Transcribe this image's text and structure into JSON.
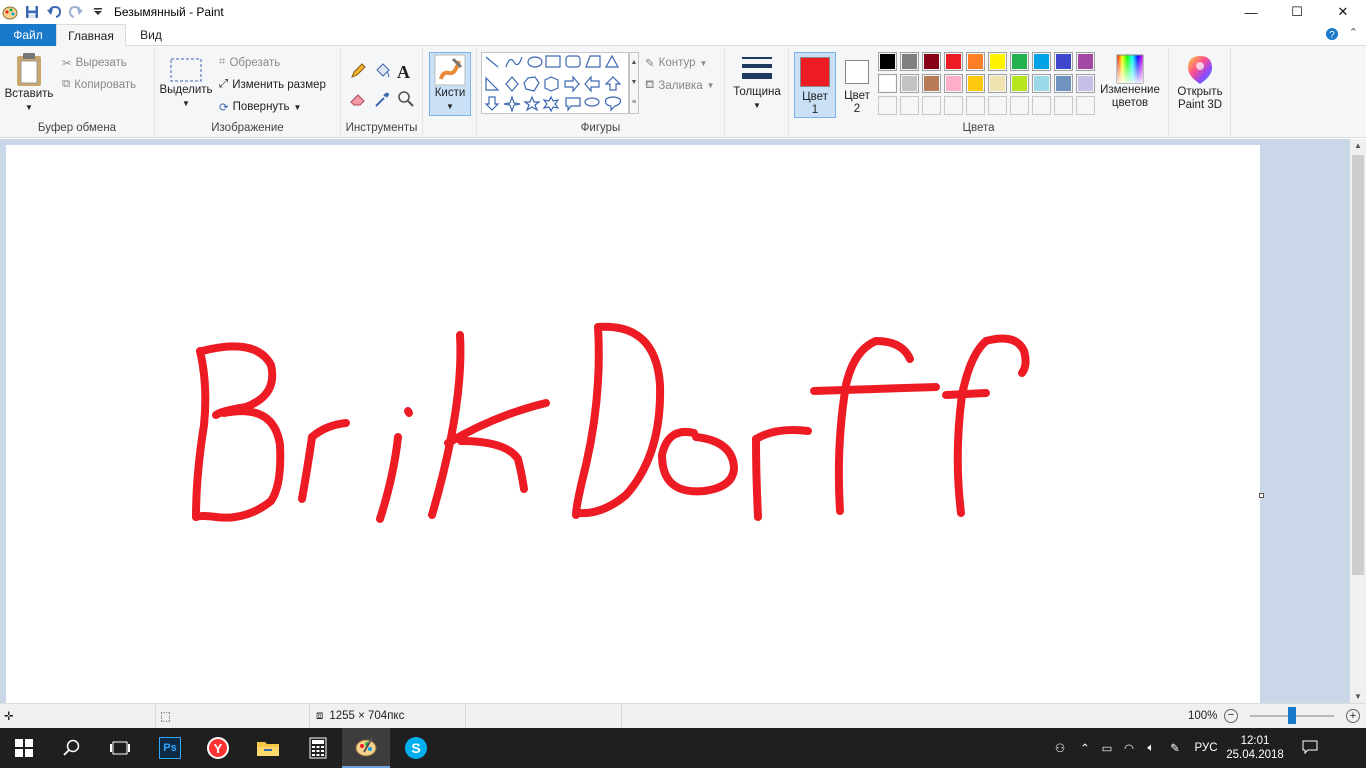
{
  "window": {
    "title": "Безымянный - Paint",
    "controls": {
      "minimize": "—",
      "maximize": "☐",
      "close": "✕"
    }
  },
  "tabs": {
    "file": "Файл",
    "home": "Главная",
    "view": "Вид"
  },
  "ribbon": {
    "clipboard": {
      "paste": "Вставить",
      "cut": "Вырезать",
      "copy": "Копировать",
      "label": "Буфер обмена"
    },
    "image": {
      "select": "Выделить",
      "crop": "Обрезать",
      "resize": "Изменить размер",
      "rotate": "Повернуть",
      "label": "Изображение"
    },
    "tools": {
      "label": "Инструменты"
    },
    "brushes": {
      "label": "Кисти"
    },
    "shapes": {
      "outline": "Контур",
      "fill": "Заливка",
      "label": "Фигуры"
    },
    "size": {
      "label": "Толщина"
    },
    "colors": {
      "color1_line1": "Цвет",
      "color1_line2": "1",
      "color2_line1": "Цвет",
      "color2_line2": "2",
      "edit_line1": "Изменение",
      "edit_line2": "цветов",
      "label": "Цвета",
      "color1": "#ed1c24",
      "color2": "#ffffff",
      "palette_row1": [
        "#000000",
        "#7f7f7f",
        "#880015",
        "#ed1c24",
        "#ff7f27",
        "#fff200",
        "#22b14c",
        "#00a2e8",
        "#3f48cc",
        "#a349a4"
      ],
      "palette_row2": [
        "#ffffff",
        "#c3c3c3",
        "#b97a57",
        "#ffaec9",
        "#ffc90e",
        "#efe4b0",
        "#b5e61d",
        "#99d9ea",
        "#7092be",
        "#c8bfe7"
      ]
    },
    "paint3d": {
      "line1": "Открыть",
      "line2": "Paint 3D"
    }
  },
  "drawing": {
    "ink_color": "#ed1c24"
  },
  "status": {
    "dimensions": "1255 × 704пкс",
    "zoom": "100%",
    "zoom_fraction": 0.5
  },
  "taskbar": {
    "apps": [
      "start-icon",
      "search-icon",
      "task-view-icon",
      "photoshop-icon",
      "yandex-browser-icon",
      "file-explorer-icon",
      "calculator-icon",
      "paint-icon",
      "skype-icon"
    ],
    "photoshop": "Ps",
    "lang": "РУС",
    "time": "12:01",
    "date": "25.04.2018"
  }
}
